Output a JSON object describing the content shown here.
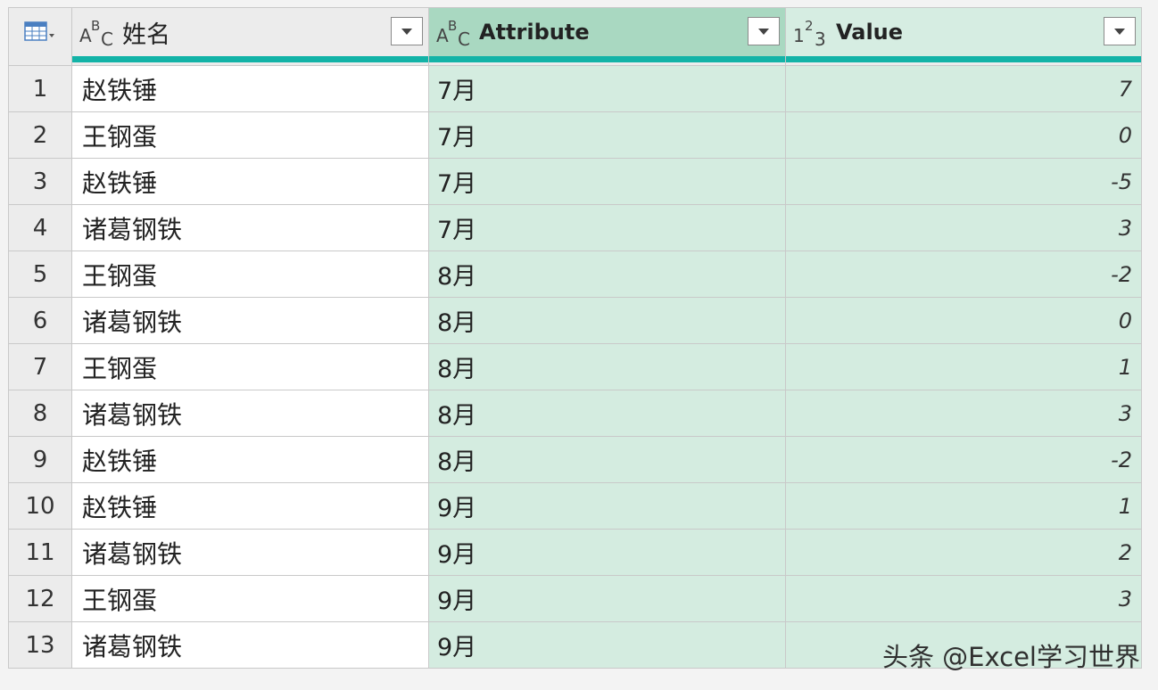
{
  "header": {
    "corner_icon": "table-menu-icon",
    "columns": [
      {
        "name": "姓名",
        "type_icon": "text-type-icon",
        "type_glyphs": [
          "A",
          "B",
          "C"
        ]
      },
      {
        "name": "Attribute",
        "type_icon": "text-type-icon",
        "type_glyphs": [
          "A",
          "B",
          "C"
        ]
      },
      {
        "name": "Value",
        "type_icon": "number-type-icon",
        "type_glyphs": [
          "1",
          "2",
          "3"
        ]
      }
    ],
    "dropdown_icon": "chevron-down-icon"
  },
  "colors": {
    "selected_column_header": "#a9d8c1",
    "selected_column_cells": "#d4ece0",
    "quality_bar": "#13b3a7",
    "row_header": "#ececec"
  },
  "rows": [
    {
      "n": "1",
      "name": "赵铁锤",
      "attr": "7月",
      "value": "7"
    },
    {
      "n": "2",
      "name": "王钢蛋",
      "attr": "7月",
      "value": "0"
    },
    {
      "n": "3",
      "name": "赵铁锤",
      "attr": "7月",
      "value": "-5"
    },
    {
      "n": "4",
      "name": "诸葛钢铁",
      "attr": "7月",
      "value": "3"
    },
    {
      "n": "5",
      "name": "王钢蛋",
      "attr": "8月",
      "value": "-2"
    },
    {
      "n": "6",
      "name": "诸葛钢铁",
      "attr": "8月",
      "value": "0"
    },
    {
      "n": "7",
      "name": "王钢蛋",
      "attr": "8月",
      "value": "1"
    },
    {
      "n": "8",
      "name": "诸葛钢铁",
      "attr": "8月",
      "value": "3"
    },
    {
      "n": "9",
      "name": "赵铁锤",
      "attr": "8月",
      "value": "-2"
    },
    {
      "n": "10",
      "name": "赵铁锤",
      "attr": "9月",
      "value": "1"
    },
    {
      "n": "11",
      "name": "诸葛钢铁",
      "attr": "9月",
      "value": "2"
    },
    {
      "n": "12",
      "name": "王钢蛋",
      "attr": "9月",
      "value": "3"
    },
    {
      "n": "13",
      "name": "诸葛钢铁",
      "attr": "9月",
      "value": ""
    }
  ],
  "watermark": "头条 @Excel学习世界"
}
